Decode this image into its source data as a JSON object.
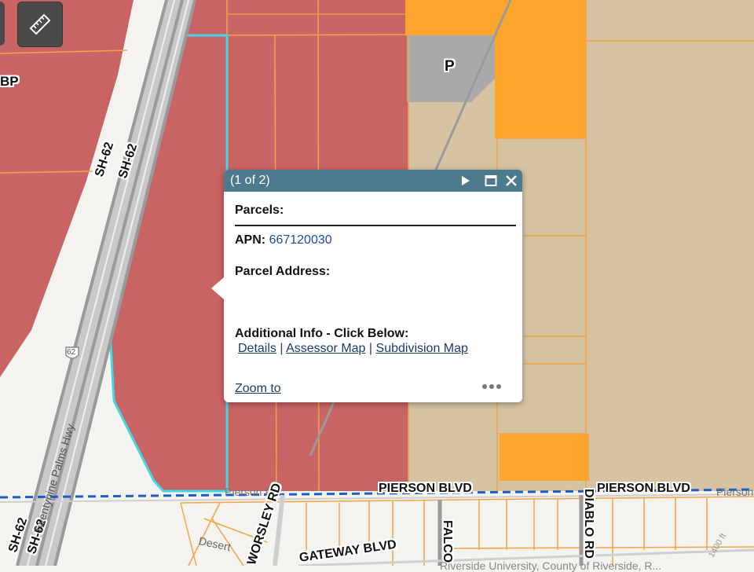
{
  "map": {
    "labels": {
      "bp": "BP",
      "p": "P",
      "sh62_a": "SH-62",
      "sh62_b": "SH-62",
      "sh62_c": "SH-62",
      "sh62_d": "SH-62",
      "shield62": "62",
      "twentynine": "Twentynine Palms Hwy",
      "pierson_left": "PIERSON BLVD",
      "pierson_right": "PIERSON BLVD",
      "pierson_thin_left": "Pierson Rd",
      "pierson_thin_right": "Pierson",
      "worsley": "WORSLEY RD",
      "gateway": "GATEWAY BLVD",
      "falco": "FALCO",
      "diablo": "DIABLO RD",
      "desert": "Desert",
      "dist": "1400 ft",
      "attribution": "Riverside University, County of Riverside, R..."
    },
    "colors": {
      "commercial": "#c96464",
      "orange": "#fda52c",
      "tan": "#d5c3a1",
      "gray_parcel": "#a9a9a9",
      "selected_outline": "#3fd9e6",
      "parcel_line": "#f1a546",
      "blue_road": "#1f5cc4"
    }
  },
  "toolbar": {
    "measure_icon": "ruler-icon"
  },
  "popup": {
    "title": "(1 of 2)",
    "header_icons": [
      "next-icon",
      "maximize-icon",
      "close-icon"
    ],
    "section_label": "Parcels:",
    "apn_label": "APN:",
    "apn_value": "667120030",
    "address_label": "Parcel Address:",
    "additional_label": "Additional Info - Click Below:",
    "links": {
      "details": "Details",
      "assessor": "Assessor Map",
      "subdivision": "Subdivision Map",
      "separator": "|"
    },
    "zoom_label": "Zoom to",
    "more_icon": "more-horizontal-icon"
  }
}
